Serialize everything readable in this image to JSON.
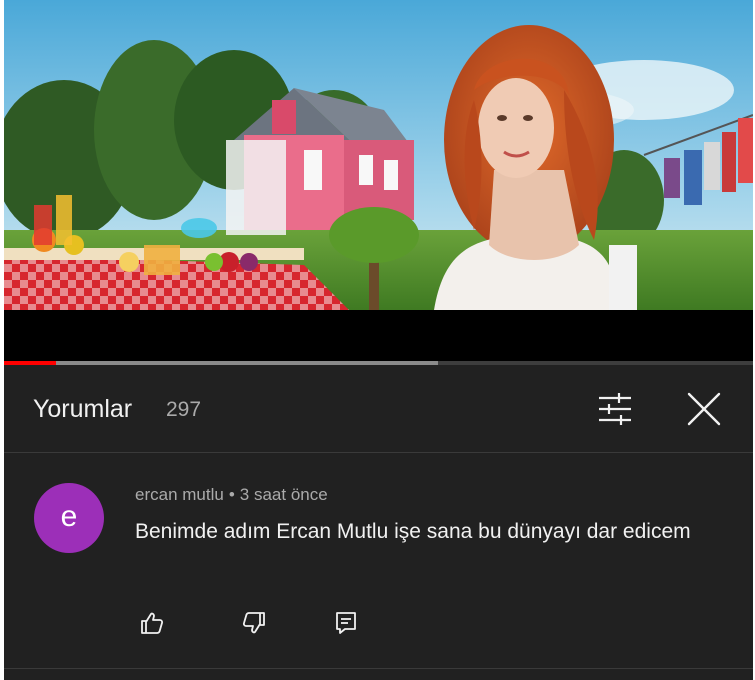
{
  "player": {
    "progress_played": 0.07,
    "progress_buffered": 0.58,
    "accent_color": "#ff0000"
  },
  "comments_panel": {
    "title": "Yorumlar",
    "count": "297",
    "filter_icon": "sort-filter-icon",
    "close_icon": "close-icon"
  },
  "comment": {
    "avatar_letter": "e",
    "avatar_color": "#9c2fb8",
    "author": "ercan mutlu",
    "separator": "•",
    "time": "3 saat önce",
    "text": "Benimde adım Ercan Mutlu işe sana bu dünyayı dar edicem",
    "actions": [
      "like-icon",
      "dislike-icon",
      "reply-icon"
    ]
  }
}
